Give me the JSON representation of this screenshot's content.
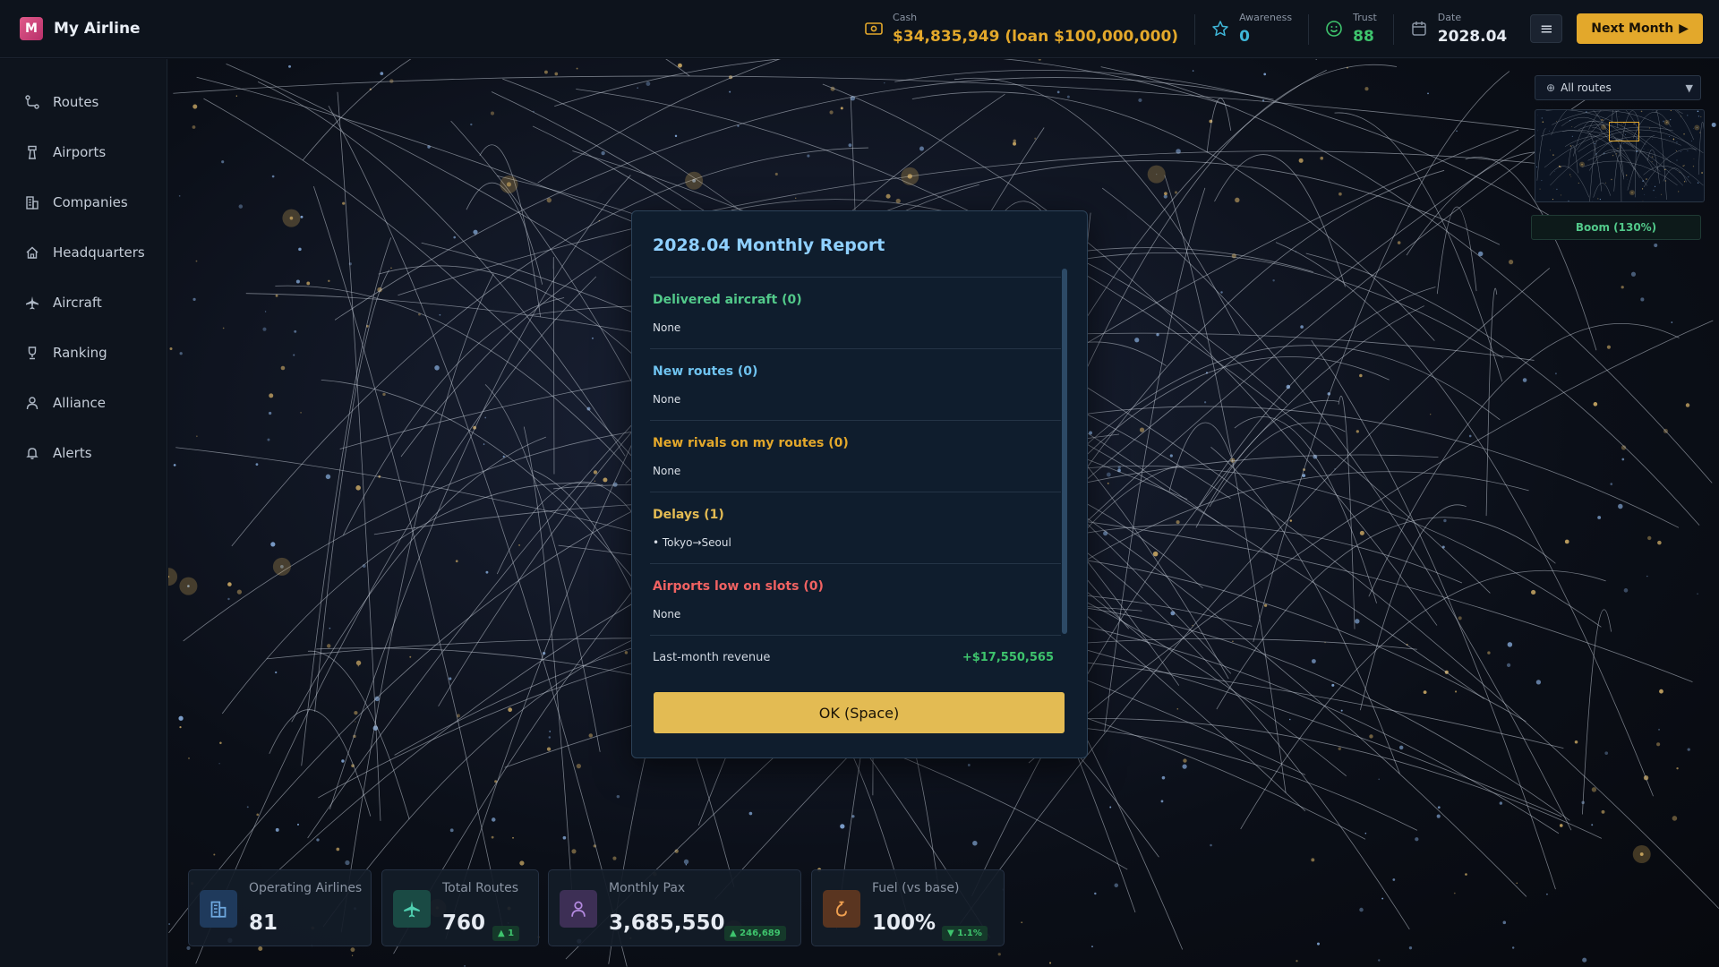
{
  "app": {
    "logo_letter": "M",
    "title": "My Airline"
  },
  "header": {
    "cash": {
      "label": "Cash",
      "value": "$34,835,949 (loan $100,000,000)",
      "color": "#e3a82b"
    },
    "awareness": {
      "label": "Awareness",
      "value": "0",
      "color": "#3fb7d9"
    },
    "trust": {
      "label": "Trust",
      "value": "88",
      "color": "#3ec46d"
    },
    "date": {
      "label": "Date",
      "value": "2028.04",
      "color": "#e6ebf2"
    },
    "next_button": "Next Month"
  },
  "sidebar": {
    "items": [
      {
        "label": "Routes",
        "icon": "route-icon"
      },
      {
        "label": "Airports",
        "icon": "tower-icon"
      },
      {
        "label": "Companies",
        "icon": "building-icon"
      },
      {
        "label": "Headquarters",
        "icon": "home-icon"
      },
      {
        "label": "Aircraft",
        "icon": "plane-icon"
      },
      {
        "label": "Ranking",
        "icon": "trophy-icon"
      },
      {
        "label": "Alliance",
        "icon": "person-icon"
      },
      {
        "label": "Alerts",
        "icon": "bell-icon"
      }
    ]
  },
  "map": {
    "filter": "All routes",
    "economy": "Boom (130%)"
  },
  "report": {
    "title": "2028.04 Monthly Report",
    "sections": [
      {
        "heading": "Delivered aircraft (0)",
        "text": "None",
        "color": "#52c98a"
      },
      {
        "heading": "New routes (0)",
        "text": "None",
        "color": "#6fc3f0"
      },
      {
        "heading": "New rivals on my routes (0)",
        "text": "None",
        "color": "#e3a82b"
      },
      {
        "heading": "Delays (1)",
        "text": "• Tokyo→Seoul",
        "color": "#e3bb53"
      },
      {
        "heading": "Airports low on slots (0)",
        "text": "None",
        "color": "#f06262"
      }
    ],
    "revenue_label": "Last-month revenue",
    "revenue_value": "+$17,550,565",
    "revenue_color": "#3ec46d",
    "ok_button": "OK (Space)"
  },
  "bottom_cards": [
    {
      "label": "Operating Airlines",
      "value": "81",
      "icon": "building-icon",
      "icon_bg": "#1f3a5c",
      "icon_color": "#6fa9e0"
    },
    {
      "label": "Total Routes",
      "value": "760",
      "change": "▲ 1",
      "change_dir": "up",
      "icon": "plane-icon",
      "icon_bg": "#1a4a44",
      "icon_color": "#4fd0b0"
    },
    {
      "label": "Monthly Pax",
      "value": "3,685,550",
      "change": "▲ 246,689",
      "change_dir": "up",
      "icon": "person-icon",
      "icon_bg": "#3d2f55",
      "icon_color": "#b48ae0"
    },
    {
      "label": "Fuel (vs base)",
      "value": "100%",
      "change": "▼ 1.1%",
      "change_dir": "down",
      "icon": "fuel-icon",
      "icon_bg": "#5a3520",
      "icon_color": "#f0a050"
    }
  ]
}
